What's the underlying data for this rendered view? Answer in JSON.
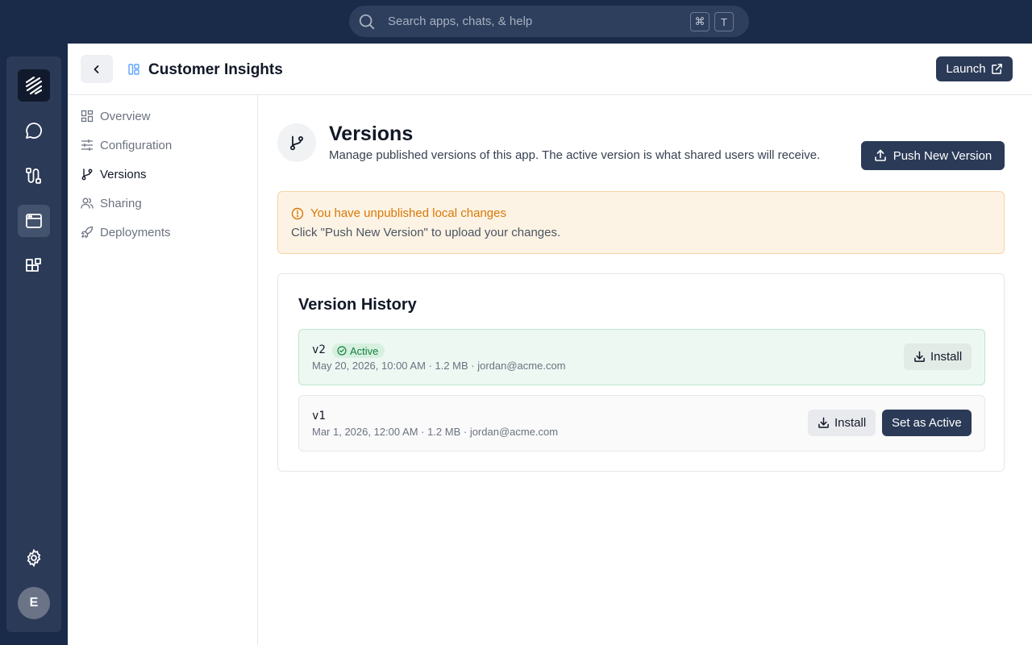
{
  "search": {
    "placeholder": "Search apps, chats, & help",
    "shortcut_key1": "⌘",
    "shortcut_key2": "T"
  },
  "rail": {
    "items": [
      {
        "icon": "logo-icon"
      },
      {
        "icon": "chat-icon"
      },
      {
        "icon": "workflow-icon"
      },
      {
        "icon": "apps-window-icon",
        "active": true
      },
      {
        "icon": "extensions-icon"
      }
    ],
    "settings_icon": "gear-icon",
    "avatar_letter": "E"
  },
  "header": {
    "title": "Customer Insights",
    "launch_label": "Launch"
  },
  "subnav": {
    "items": [
      {
        "label": "Overview",
        "icon": "grid-icon"
      },
      {
        "label": "Configuration",
        "icon": "sliders-icon"
      },
      {
        "label": "Versions",
        "icon": "git-branch-icon",
        "active": true
      },
      {
        "label": "Sharing",
        "icon": "users-icon"
      },
      {
        "label": "Deployments",
        "icon": "rocket-icon"
      }
    ]
  },
  "versions": {
    "title": "Versions",
    "description": "Manage published versions of this app. The active version is what shared users will receive.",
    "push_label": "Push New Version"
  },
  "alert": {
    "title": "You have unpublished local changes",
    "text": "Click \"Push New Version\" to upload your changes."
  },
  "history": {
    "title": "Version History",
    "rows": [
      {
        "version": "v2",
        "badge": "Active",
        "meta": "May 20, 2026, 10:00 AM · 1.2 MB · jordan@acme.com",
        "install_label": "Install"
      },
      {
        "version": "v1",
        "meta": "Mar 1, 2026, 12:00 AM · 1.2 MB · jordan@acme.com",
        "install_label": "Install",
        "set_active_label": "Set as Active"
      }
    ]
  },
  "colors": {
    "navy": "#2b3a57",
    "topbar": "#1a2b4a",
    "warning": "#d97706",
    "success": "#15803d"
  }
}
